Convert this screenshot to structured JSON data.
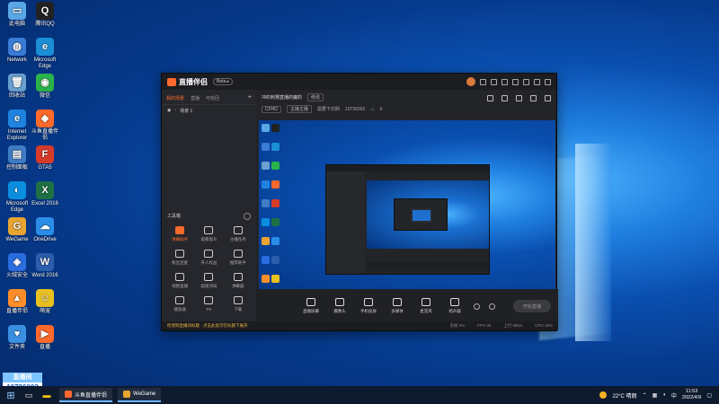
{
  "desktop": {
    "icons": [
      {
        "label": "此电脑",
        "color": "#5aa7e8",
        "glyph": "▭"
      },
      {
        "label": "腾讯QQ",
        "color": "#222",
        "glyph": "Q"
      },
      {
        "label": "Network",
        "color": "#3a7bd5",
        "glyph": "◍"
      },
      {
        "label": "Microsoft Edge",
        "color": "#1a8fd6",
        "glyph": "e"
      },
      {
        "label": "回收站",
        "color": "#6aa0d0",
        "glyph": "🗑"
      },
      {
        "label": "微信",
        "color": "#2ab34a",
        "glyph": "◉"
      },
      {
        "label": "Internet Explorer",
        "color": "#1f84e0",
        "glyph": "e"
      },
      {
        "label": "斗鱼直播伴侣",
        "color": "#ff6a2c",
        "glyph": "◆"
      },
      {
        "label": "控制面板",
        "color": "#3f7cc4",
        "glyph": "▤"
      },
      {
        "label": "GTA5",
        "color": "#d83a2a",
        "glyph": "F"
      },
      {
        "label": "Microsoft Edge",
        "color": "#0c8ee0",
        "glyph": "◐"
      },
      {
        "label": "Excel 2016",
        "color": "#1e7145",
        "glyph": "X"
      },
      {
        "label": "WeGame",
        "color": "#e8a531",
        "glyph": "G"
      },
      {
        "label": "OneDrive",
        "color": "#2a8ee8",
        "glyph": "☁"
      },
      {
        "label": "火绒安全",
        "color": "#2a6de0",
        "glyph": "◈"
      },
      {
        "label": "Word 2016",
        "color": "#2b5ead",
        "glyph": "W"
      },
      {
        "label": "直播伴侣",
        "color": "#ff8e2a",
        "glyph": "▲"
      },
      {
        "label": "萌宠",
        "color": "#e8c020",
        "glyph": "☺"
      },
      {
        "label": "文件夹",
        "color": "#3a8fe0",
        "glyph": "♥"
      },
      {
        "label": "直播",
        "color": "#ff6a2c",
        "glyph": "▶"
      }
    ],
    "stream_id_top": "直播间",
    "stream_id": "10736003"
  },
  "app": {
    "logo_text": "直播伴侣",
    "version": "Beta ▸",
    "scene_tabs": [
      "我的场景",
      "直播",
      "可收回"
    ],
    "scene_row_label": "场景 1",
    "tools_title": "工具箱",
    "tools": [
      {
        "label": "弹幕助手",
        "hot": true
      },
      {
        "label": "观看观众",
        "hot": false
      },
      {
        "label": "主播任务",
        "hot": false
      },
      {
        "label": "粉丝连麦",
        "hot": false
      },
      {
        "label": "开人权益",
        "hot": false
      },
      {
        "label": "推荐助手",
        "hot": false
      },
      {
        "label": "视频直播",
        "hot": false
      },
      {
        "label": "超级对局",
        "hot": false
      },
      {
        "label": "弹幕器",
        "hot": false
      },
      {
        "label": "播放器",
        "hot": false
      },
      {
        "label": "PK",
        "hot": false
      },
      {
        "label": "下载",
        "hot": false
      }
    ],
    "room_title": "冲的刺猬直播的魔的",
    "room_tag": "修改",
    "room_category": "CFHD",
    "room_host": "主播主播",
    "room_meta": "需要下次刷",
    "room_id": "10736003",
    "room_count": "0",
    "bottom_actions": [
      "直播屏幕",
      "摄像头",
      "手机投屏",
      "多媒体",
      "麦克风",
      "扬声器"
    ],
    "go_live_label": "开始直播",
    "status_warning": "检测到直播间标题 · 点击此处可在标题下展开",
    "status_stats": [
      "丢帧 0%",
      "FPS 30",
      "上行 0kb/s",
      "CPU 10%"
    ]
  },
  "taskbar": {
    "apps": [
      {
        "label": "斗鱼直播伴侣",
        "color": "#ff6a2c"
      },
      {
        "label": "WeGame",
        "color": "#e8a531"
      }
    ],
    "weather": "22°C 晴朗",
    "time": "11:53",
    "date": "2022/4/9"
  }
}
